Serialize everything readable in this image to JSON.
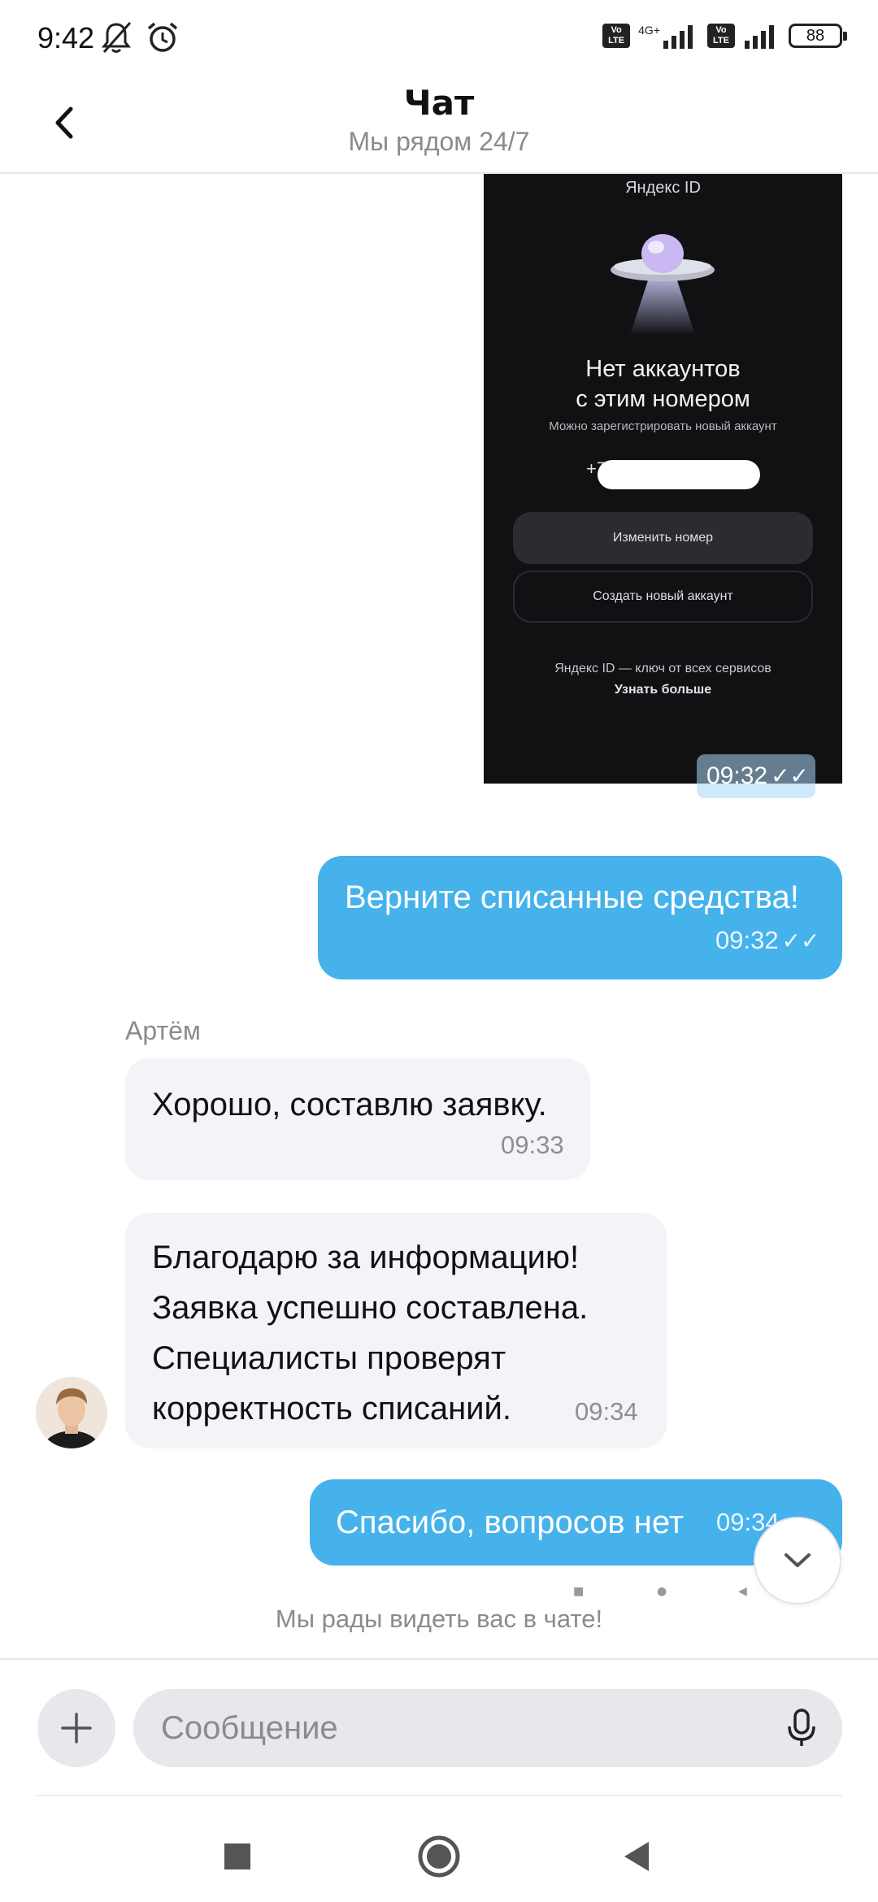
{
  "status_bar": {
    "time": "9:42",
    "network_type": "4G+",
    "volte_label": "Vo LTE",
    "battery": "88"
  },
  "header": {
    "title": "Чат",
    "subtitle": "Мы рядом 24/7"
  },
  "screenshot_message": {
    "brand": "Яндекс ID",
    "title_line1": "Нет аккаунтов",
    "title_line2": "с этим номером",
    "subtitle": "Можно зарегистрировать новый аккаунт",
    "phone_prefix": "+7",
    "button_change": "Изменить номер",
    "button_create": "Создать новый аккаунт",
    "footer_line1": "Яндекс ID — ключ от всех сервисов",
    "footer_line2": "Узнать больше",
    "time": "09:32"
  },
  "messages": [
    {
      "direction": "out",
      "text": "Верните списанные средства!",
      "time": "09:32",
      "read": true
    },
    {
      "direction": "in",
      "sender": "Артём",
      "text": "Хорошо, составлю заявку.",
      "time": "09:33"
    },
    {
      "direction": "in",
      "lines": [
        "Благодарю за информацию!",
        "Заявка успешно составлена.",
        "Специалисты проверят",
        "корректность списаний."
      ],
      "time": "09:34"
    },
    {
      "direction": "out",
      "text": "Спасибо, вопросов нет",
      "time": "09:34"
    }
  ],
  "welcome_text": "Мы рады видеть вас в чате!",
  "composer": {
    "placeholder": "Сообщение"
  },
  "colors": {
    "outgoing_bubble": "#45b2ec",
    "incoming_bubble": "#f3f4f8"
  },
  "icons": [
    "back-arrow-icon",
    "mute-icon",
    "alarm-icon",
    "signal-icon",
    "battery-icon",
    "check-icon",
    "chevron-down-icon",
    "plus-icon",
    "microphone-icon",
    "square-icon",
    "circle-icon",
    "triangle-back-icon"
  ]
}
